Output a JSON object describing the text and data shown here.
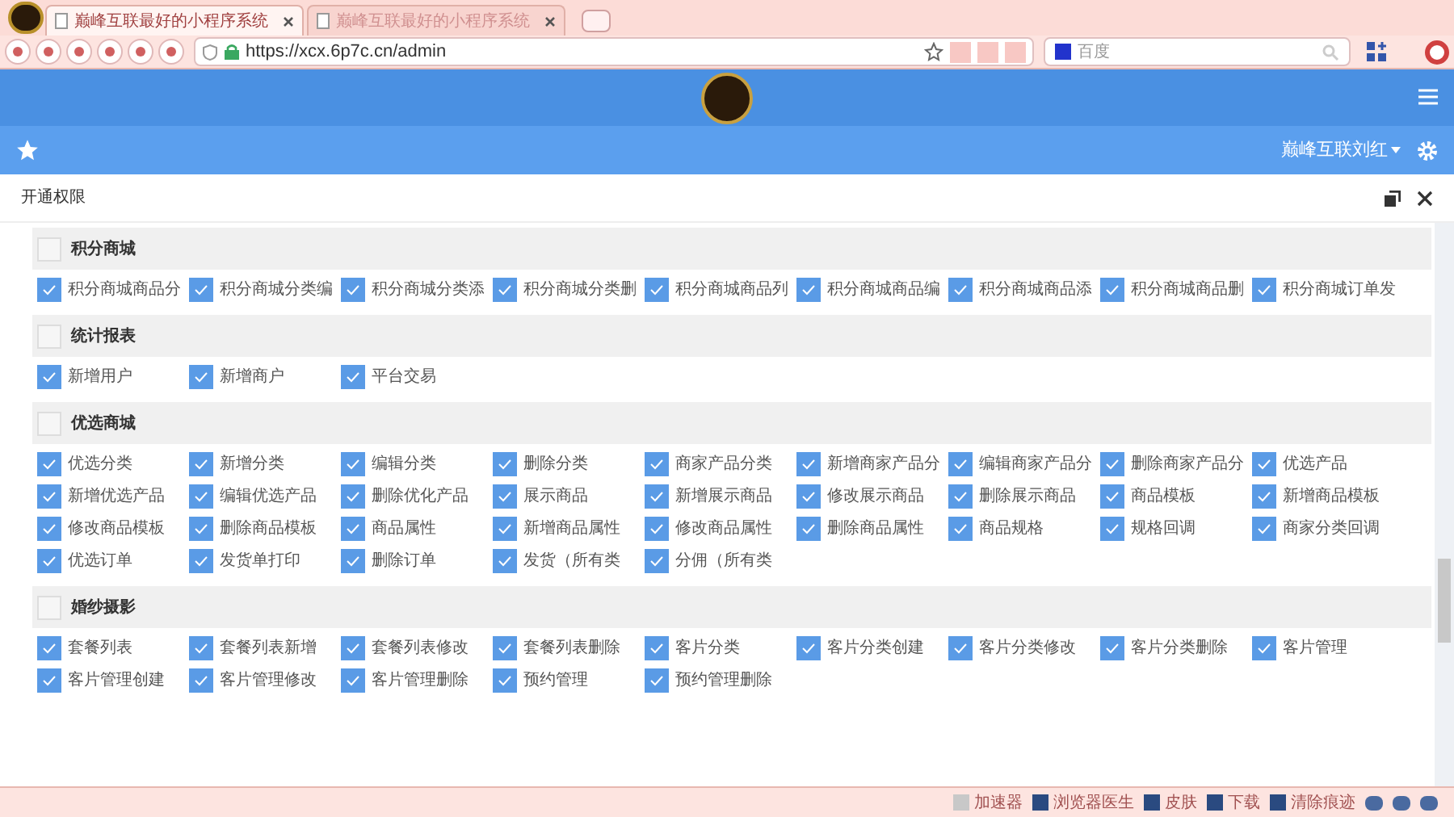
{
  "browser": {
    "tabs": [
      {
        "title": "巅峰互联最好的小程序系统",
        "selected": true
      },
      {
        "title": "巅峰互联最好的小程序系统",
        "selected": false
      }
    ],
    "url": "https://xcx.6p7c.cn/admin",
    "search_placeholder": "百度"
  },
  "header": {
    "user": "巅峰互联刘红"
  },
  "panel": {
    "title": "开通权限"
  },
  "sections": [
    {
      "title": "积分商城",
      "checked": false,
      "items": [
        {
          "label": "积分商城商品分",
          "checked": true
        },
        {
          "label": "积分商城分类编",
          "checked": true
        },
        {
          "label": "积分商城分类添",
          "checked": true
        },
        {
          "label": "积分商城分类删",
          "checked": true
        },
        {
          "label": "积分商城商品列",
          "checked": true
        },
        {
          "label": "积分商城商品编",
          "checked": true
        },
        {
          "label": "积分商城商品添",
          "checked": true
        },
        {
          "label": "积分商城商品删",
          "checked": true
        },
        {
          "label": "积分商城订单发",
          "checked": true
        }
      ]
    },
    {
      "title": "统计报表",
      "checked": false,
      "items": [
        {
          "label": "新增用户",
          "checked": true
        },
        {
          "label": "新增商户",
          "checked": true
        },
        {
          "label": "平台交易",
          "checked": true
        }
      ]
    },
    {
      "title": "优选商城",
      "checked": false,
      "items": [
        {
          "label": "优选分类",
          "checked": true
        },
        {
          "label": "新增分类",
          "checked": true
        },
        {
          "label": "编辑分类",
          "checked": true
        },
        {
          "label": "删除分类",
          "checked": true
        },
        {
          "label": "商家产品分类",
          "checked": true
        },
        {
          "label": "新增商家产品分",
          "checked": true
        },
        {
          "label": "编辑商家产品分",
          "checked": true
        },
        {
          "label": "删除商家产品分",
          "checked": true
        },
        {
          "label": "优选产品",
          "checked": true
        },
        {
          "label": "新增优选产品",
          "checked": true
        },
        {
          "label": "编辑优选产品",
          "checked": true
        },
        {
          "label": "删除优化产品",
          "checked": true
        },
        {
          "label": "展示商品",
          "checked": true
        },
        {
          "label": "新增展示商品",
          "checked": true
        },
        {
          "label": "修改展示商品",
          "checked": true
        },
        {
          "label": "删除展示商品",
          "checked": true
        },
        {
          "label": "商品模板",
          "checked": true
        },
        {
          "label": "新增商品模板",
          "checked": true
        },
        {
          "label": "修改商品模板",
          "checked": true
        },
        {
          "label": "删除商品模板",
          "checked": true
        },
        {
          "label": "商品属性",
          "checked": true
        },
        {
          "label": "新增商品属性",
          "checked": true
        },
        {
          "label": "修改商品属性",
          "checked": true
        },
        {
          "label": "删除商品属性",
          "checked": true
        },
        {
          "label": "商品规格",
          "checked": true
        },
        {
          "label": "规格回调",
          "checked": true
        },
        {
          "label": "商家分类回调",
          "checked": true
        },
        {
          "label": "优选订单",
          "checked": true
        },
        {
          "label": "发货单打印",
          "checked": true
        },
        {
          "label": "删除订单",
          "checked": true
        },
        {
          "label": "发货（所有类",
          "checked": true
        },
        {
          "label": "分佣（所有类",
          "checked": true
        }
      ]
    },
    {
      "title": "婚纱摄影",
      "checked": false,
      "items": [
        {
          "label": "套餐列表",
          "checked": true
        },
        {
          "label": "套餐列表新增",
          "checked": true
        },
        {
          "label": "套餐列表修改",
          "checked": true
        },
        {
          "label": "套餐列表删除",
          "checked": true
        },
        {
          "label": "客片分类",
          "checked": true
        },
        {
          "label": "客片分类创建",
          "checked": true
        },
        {
          "label": "客片分类修改",
          "checked": true
        },
        {
          "label": "客片分类删除",
          "checked": true
        },
        {
          "label": "客片管理",
          "checked": true
        },
        {
          "label": "客片管理创建",
          "checked": true
        },
        {
          "label": "客片管理修改",
          "checked": true
        },
        {
          "label": "客片管理删除",
          "checked": true
        },
        {
          "label": "预约管理",
          "checked": true
        },
        {
          "label": "预约管理删除",
          "checked": true
        }
      ]
    }
  ],
  "status_bar": [
    "加速器",
    "浏览器医生",
    "皮肤",
    "下载",
    "清除痕迹"
  ]
}
